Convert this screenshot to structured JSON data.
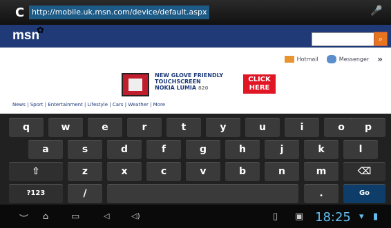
{
  "browser": {
    "url": "http://mobile.uk.msn.com/device/default.aspx",
    "reload_icon": "C",
    "mic_icon": "🎤"
  },
  "msn": {
    "logo": "msn",
    "links": {
      "hotmail": "Hotmail",
      "messenger": "Messenger",
      "more": "»"
    },
    "ad": {
      "line1": "NEW GLOVE FRIENDLY",
      "line2": "TOUCHSCREEN",
      "line3": "NOKIA LUMIA",
      "line3_model": "820",
      "click_line1": "CLICK",
      "click_line2": "HERE"
    },
    "nav": "News | Sport | Entertainment | Lifestyle | Cars | Weather | More"
  },
  "keyboard": {
    "row1": [
      "q",
      "w",
      "e",
      "r",
      "t",
      "y",
      "u",
      "i",
      "o",
      "p"
    ],
    "row2": [
      "a",
      "s",
      "d",
      "f",
      "g",
      "h",
      "j",
      "k",
      "l"
    ],
    "row3": [
      "⇧",
      "z",
      "x",
      "c",
      "v",
      "b",
      "n",
      "m",
      "⌫"
    ],
    "row4": [
      "?123",
      "/",
      "",
      ".",
      "Go"
    ]
  },
  "system_bar": {
    "back_icon": "back-icon",
    "home_icon": "home-icon",
    "recent_icon": "recent-apps-icon",
    "vol_down_icon": "volume-down-icon",
    "vol_up_icon": "volume-up-icon",
    "time": "18:25"
  }
}
